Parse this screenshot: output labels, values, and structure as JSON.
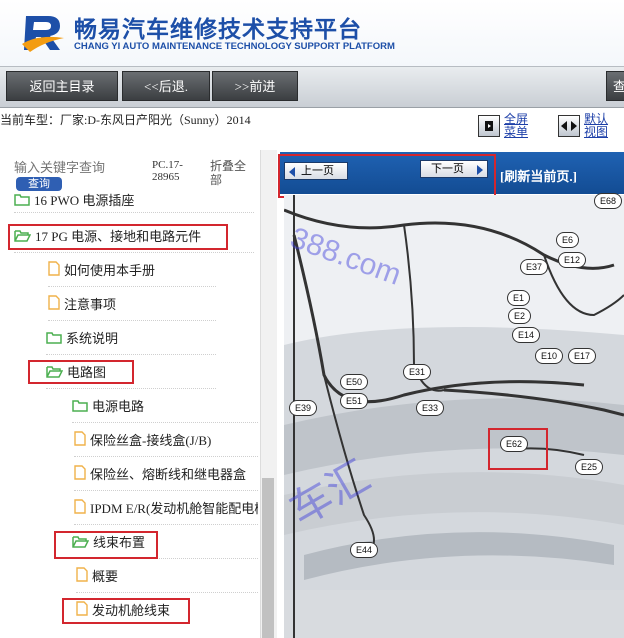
{
  "header": {
    "title": "畅易汽车维修技术支持平台",
    "subtitle": "CHANG YI AUTO MAINTENANCE TECHNOLOGY SUPPORT PLATFORM"
  },
  "navbar": {
    "home": "返回主目录",
    "back": "<<后退.",
    "forward": ">>前进",
    "right_cut": "查"
  },
  "model_info": "当前车型：厂家:D-东风日产阳光（Sunny）2014",
  "view_options": {
    "full_menu": "全屏菜单",
    "default_view": "默认视图"
  },
  "sidebar": {
    "search_placeholder": "输入关键字查询",
    "search_button": "查询",
    "pc_code": "PC.17-28965",
    "collapse_all": "折叠全部",
    "items": [
      {
        "label": "16 PWO 电源插座",
        "icon": "folder-icon"
      },
      {
        "label": "17 PG 电源、接地和电路元件",
        "icon": "folder-open-icon"
      },
      {
        "label": "如何使用本手册",
        "icon": "file-icon"
      },
      {
        "label": "注意事项",
        "icon": "file-icon"
      },
      {
        "label": "系统说明",
        "icon": "folder-icon"
      },
      {
        "label": "电路图",
        "icon": "folder-open-icon"
      },
      {
        "label": "电源电路",
        "icon": "folder-icon"
      },
      {
        "label": "保险丝盒-接线盒(J/B)",
        "icon": "file-icon"
      },
      {
        "label": "保险丝、熔断线和继电器盒",
        "icon": "file-icon"
      },
      {
        "label": "IPDM E/R(发动机舱智能配电模块)",
        "icon": "file-icon"
      },
      {
        "label": "线束布置",
        "icon": "folder-open-icon"
      },
      {
        "label": "概要",
        "icon": "file-icon"
      },
      {
        "label": "发动机舱线束",
        "icon": "file-icon"
      }
    ]
  },
  "viewer": {
    "prev_page": "上一页",
    "next_page": "下一页",
    "refresh": "[刷新当前页.]",
    "watermark_url": "388.com",
    "watermark_cn": "车汇",
    "connectors": [
      "E68",
      "E6",
      "E12",
      "E37",
      "E1",
      "E2",
      "E14",
      "E10",
      "E17",
      "E31",
      "E50",
      "E51",
      "E39",
      "E33",
      "E62",
      "E25",
      "E44"
    ]
  },
  "colors": {
    "brand_blue": "#1d4fa8",
    "toolbar_blue": "#1a5aa8",
    "highlight_red": "#d3262e",
    "folder_green": "#4caf50",
    "file_orange": "#f0b24a"
  }
}
